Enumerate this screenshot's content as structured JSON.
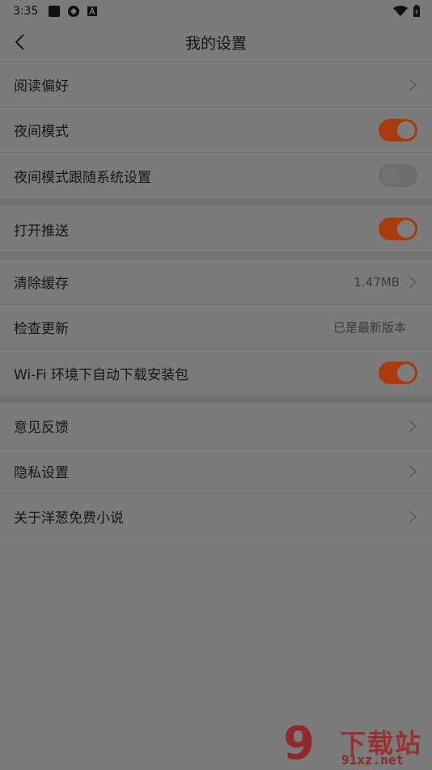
{
  "status_bar": {
    "time": "3:35"
  },
  "header": {
    "title": "我的设置"
  },
  "groups": [
    [
      {
        "label": "阅读偏好",
        "type": "chevron"
      },
      {
        "label": "夜间模式",
        "type": "toggle",
        "on": true
      },
      {
        "label": "夜间模式跟随系统设置",
        "type": "toggle",
        "on": false
      }
    ],
    [
      {
        "label": "打开推送",
        "type": "toggle",
        "on": true
      }
    ],
    [
      {
        "label": "清除缓存",
        "type": "chevron",
        "value": "1.47MB"
      },
      {
        "label": "检查更新",
        "type": "text",
        "value": "已是最新版本"
      },
      {
        "label": "Wi-Fi 环境下自动下载安装包",
        "type": "toggle",
        "on": true
      }
    ],
    [
      {
        "label": "意见反馈",
        "type": "chevron"
      },
      {
        "label": "隐私设置",
        "type": "chevron"
      },
      {
        "label": "关于洋葱免费小说",
        "type": "chevron"
      }
    ]
  ],
  "watermark": {
    "logo": "9",
    "title": "下载站",
    "url": "91xz.net"
  },
  "colors": {
    "accent": "#a83a0c",
    "background": "#7b7b7b"
  }
}
